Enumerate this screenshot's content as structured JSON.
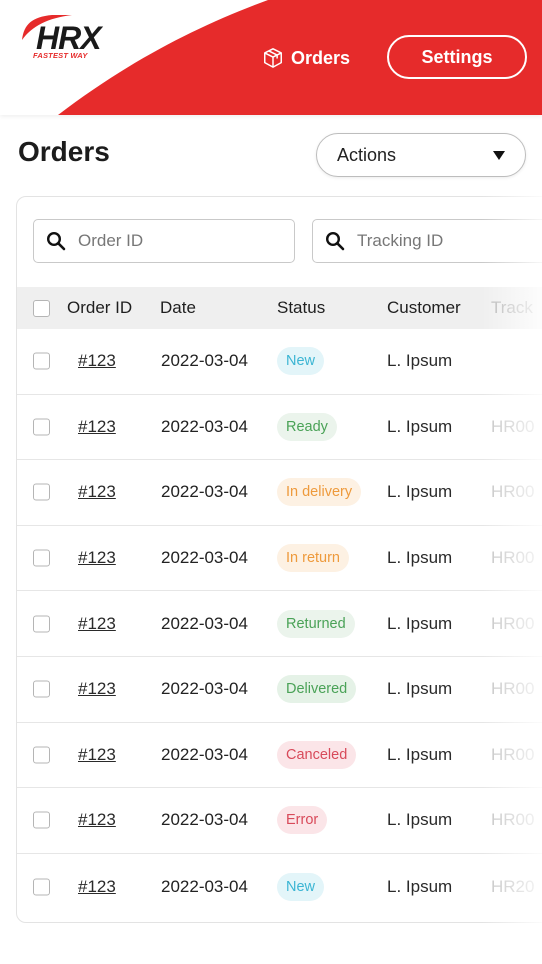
{
  "header": {
    "logo_text": "HRX",
    "logo_tagline": "FASTEST WAY",
    "brand_color": "#e62b2b",
    "nav": {
      "orders_label": "Orders",
      "orders_icon": "box-icon",
      "settings_label": "Settings"
    }
  },
  "page": {
    "title": "Orders",
    "actions_label": "Actions"
  },
  "filters": {
    "order_id_placeholder": "Order ID",
    "tracking_id_placeholder": "Tracking ID"
  },
  "table": {
    "columns": [
      "Order ID",
      "Date",
      "Status",
      "Customer",
      "Track"
    ],
    "rows": [
      {
        "order_id": "#123",
        "date": "2022-03-04",
        "status": "New",
        "customer": "L. Ipsum",
        "tracking": ""
      },
      {
        "order_id": "#123",
        "date": "2022-03-04",
        "status": "Ready",
        "customer": "L. Ipsum",
        "tracking": "HR00"
      },
      {
        "order_id": "#123",
        "date": "2022-03-04",
        "status": "In delivery",
        "customer": "L. Ipsum",
        "tracking": "HR00"
      },
      {
        "order_id": "#123",
        "date": "2022-03-04",
        "status": "In return",
        "customer": "L. Ipsum",
        "tracking": "HR00"
      },
      {
        "order_id": "#123",
        "date": "2022-03-04",
        "status": "Returned",
        "customer": "L. Ipsum",
        "tracking": "HR00"
      },
      {
        "order_id": "#123",
        "date": "2022-03-04",
        "status": "Delivered",
        "customer": "L. Ipsum",
        "tracking": "HR00"
      },
      {
        "order_id": "#123",
        "date": "2022-03-04",
        "status": "Canceled",
        "customer": "L. Ipsum",
        "tracking": "HR00"
      },
      {
        "order_id": "#123",
        "date": "2022-03-04",
        "status": "Error",
        "customer": "L. Ipsum",
        "tracking": "HR00"
      },
      {
        "order_id": "#123",
        "date": "2022-03-04",
        "status": "New",
        "customer": "L. Ipsum",
        "tracking": "HR20"
      }
    ]
  },
  "status_colors": {
    "New": {
      "text": "#3bb5d3",
      "bg": "#e3f5f9"
    },
    "Ready": {
      "text": "#4aa257",
      "bg": "#ebf4ec"
    },
    "In delivery": {
      "text": "#ee9a3c",
      "bg": "#fdf1e3"
    },
    "In return": {
      "text": "#ee9a3c",
      "bg": "#fdf1e3"
    },
    "Returned": {
      "text": "#4aa257",
      "bg": "#ebf4ec"
    },
    "Delivered": {
      "text": "#4aa257",
      "bg": "#e5f2e7"
    },
    "Canceled": {
      "text": "#d84a5a",
      "bg": "#fbe5e8"
    },
    "Error": {
      "text": "#d84a5a",
      "bg": "#fbe5e8"
    }
  }
}
